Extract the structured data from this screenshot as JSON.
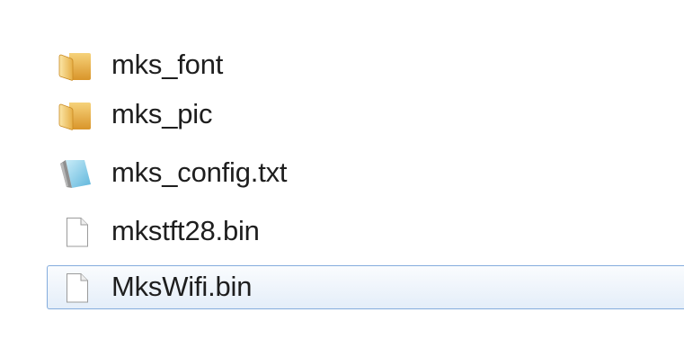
{
  "files": [
    {
      "name": "mks_font",
      "icon": "folder-icon"
    },
    {
      "name": "mks_pic",
      "icon": "folder-icon"
    },
    {
      "name": "mks_config.txt",
      "icon": "text-file-icon"
    },
    {
      "name": "mkstft28.bin",
      "icon": "blank-file-icon"
    },
    {
      "name": "MksWifi.bin",
      "icon": "blank-file-icon",
      "selected": true
    }
  ],
  "colors": {
    "selection_border": "#84acdd",
    "selection_fill": "#e4eef9",
    "folder": "#e8b74a",
    "text_file": "#7cc8e6"
  }
}
